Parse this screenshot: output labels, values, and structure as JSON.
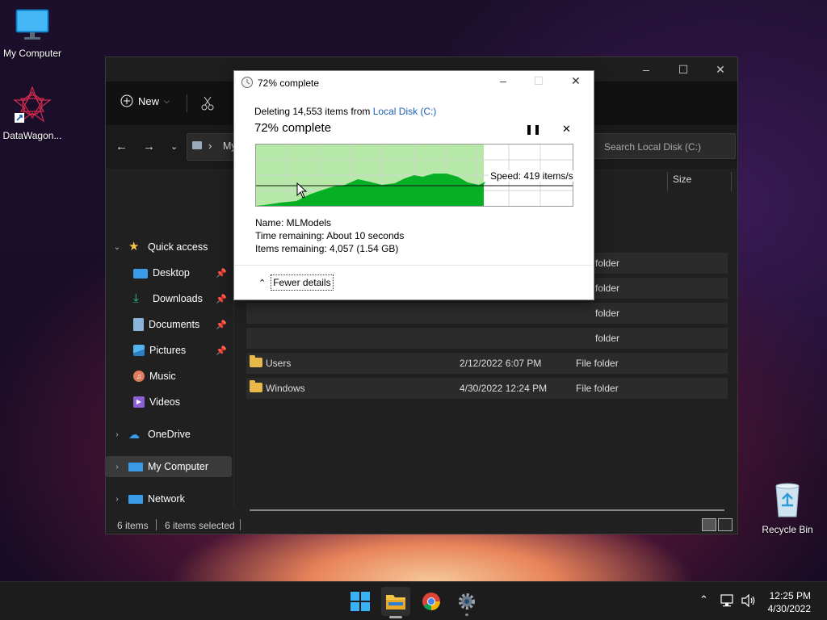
{
  "desktop": {
    "icons": [
      {
        "label": "My Computer",
        "icon": "monitor-icon"
      },
      {
        "label": "DataWagon...",
        "icon": "datawagon-shortcut-icon"
      },
      {
        "label": "Recycle Bin",
        "icon": "recycle-bin-icon"
      }
    ]
  },
  "explorer": {
    "toolbar": {
      "new_label": "New"
    },
    "address": {
      "crumb": "My"
    },
    "search": {
      "placeholder": "Search Local Disk (C:)"
    },
    "nav": {
      "quick_access": "Quick access",
      "items": [
        {
          "label": "Desktop",
          "icon": "desktop-icon"
        },
        {
          "label": "Downloads",
          "icon": "downloads-icon"
        },
        {
          "label": "Documents",
          "icon": "documents-icon"
        },
        {
          "label": "Pictures",
          "icon": "pictures-icon"
        },
        {
          "label": "Music",
          "icon": "music-icon"
        },
        {
          "label": "Videos",
          "icon": "videos-icon"
        }
      ],
      "onedrive": "OneDrive",
      "my_computer": "My Computer",
      "network": "Network"
    },
    "columns": {
      "size": "Size"
    },
    "rows": [
      {
        "name": "",
        "date": "",
        "type": "folder"
      },
      {
        "name": "",
        "date": "",
        "type": "folder"
      },
      {
        "name": "",
        "date": "",
        "type": "folder"
      },
      {
        "name": "",
        "date": "",
        "type": "folder"
      },
      {
        "name": "Users",
        "date": "2/12/2022 6:07 PM",
        "type": "File folder"
      },
      {
        "name": "Windows",
        "date": "4/30/2022 12:24 PM",
        "type": "File folder"
      }
    ],
    "status": {
      "count": "6 items",
      "selected": "6 items selected"
    }
  },
  "dialog": {
    "title": "72% complete",
    "deleting_prefix": "Deleting 14,553 items from ",
    "deleting_link": "Local Disk (C:)",
    "heading": "72% complete",
    "progress": 0.72,
    "speed": "Speed: 419 items/s",
    "name_line": "Name:  MLModels",
    "time_line": "Time remaining:  About 10 seconds",
    "items_line": "Items remaining:  4,057 (1.54 GB)",
    "fewer_details": "Fewer details",
    "colors": {
      "graph_fill": "#06b025",
      "graph_bg": "#b6e8a7"
    }
  },
  "taskbar": {
    "time": "12:25 PM",
    "date": "4/30/2022"
  }
}
